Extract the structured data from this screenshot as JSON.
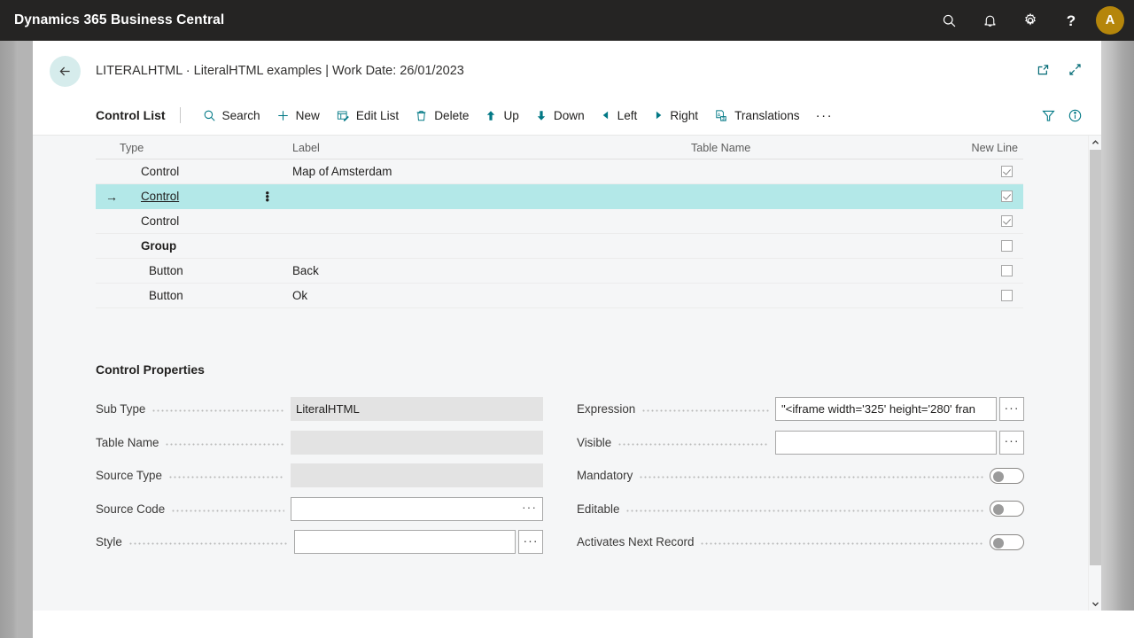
{
  "topbar": {
    "brand": "Dynamics 365 Business Central",
    "icons": {
      "search": "search-icon",
      "notifications": "bell-icon",
      "settings": "gear-icon",
      "help": "?",
      "avatar_initial": "A"
    },
    "colors": {
      "background": "#252423",
      "avatar": "#b5860b"
    }
  },
  "page_header": {
    "back_label": "back-arrow",
    "title": "LITERALHTML · LiteralHTML examples | Work Date: 26/01/2023",
    "icons": [
      "open-in-new-window-icon",
      "collapse-icon"
    ]
  },
  "command_bar": {
    "title": "Control List",
    "buttons": [
      {
        "label": "Search",
        "icon": "search-icon"
      },
      {
        "label": "New",
        "icon": "plus-icon"
      },
      {
        "label": "Edit List",
        "icon": "edit-list-icon"
      },
      {
        "label": "Delete",
        "icon": "trash-icon"
      },
      {
        "label": "Up",
        "icon": "arrow-up-icon"
      },
      {
        "label": "Down",
        "icon": "arrow-down-icon"
      },
      {
        "label": "Left",
        "icon": "triangle-left-icon"
      },
      {
        "label": "Right",
        "icon": "triangle-right-icon"
      },
      {
        "label": "Translations",
        "icon": "translations-icon"
      }
    ],
    "overflow": "···",
    "right_icons": [
      "filter-icon",
      "info-icon"
    ],
    "accent": "#017885"
  },
  "table": {
    "columns": [
      "Type",
      "Label",
      "Table Name",
      "New Line"
    ],
    "rows": [
      {
        "indicator": "",
        "type": "Control",
        "label": "Map of Amsterdam",
        "table_name": "",
        "new_line": true,
        "selected": false,
        "bold": false,
        "indent": false
      },
      {
        "indicator": "→",
        "type": "Control",
        "label": "",
        "table_name": "",
        "new_line": true,
        "selected": true,
        "bold": false,
        "indent": false
      },
      {
        "indicator": "",
        "type": "Control",
        "label": "",
        "table_name": "",
        "new_line": true,
        "selected": false,
        "bold": false,
        "indent": false
      },
      {
        "indicator": "",
        "type": "Group",
        "label": "",
        "table_name": "",
        "new_line": false,
        "selected": false,
        "bold": true,
        "indent": false
      },
      {
        "indicator": "",
        "type": "Button",
        "label": "Back",
        "table_name": "",
        "new_line": false,
        "selected": false,
        "bold": false,
        "indent": true
      },
      {
        "indicator": "",
        "type": "Button",
        "label": "Ok",
        "table_name": "",
        "new_line": false,
        "selected": false,
        "bold": false,
        "indent": true
      }
    ],
    "selected_row_color": "#b3e8e8",
    "row_kebab": "⋮"
  },
  "properties": {
    "title": "Control Properties",
    "left_fields": [
      {
        "label": "Sub Type",
        "value": "LiteralHTML",
        "control": "readonly"
      },
      {
        "label": "Table Name",
        "value": "",
        "control": "readonly"
      },
      {
        "label": "Source Type",
        "value": "",
        "control": "readonly"
      },
      {
        "label": "Source Code",
        "value": "",
        "control": "input-assist-inside"
      },
      {
        "label": "Style",
        "value": "",
        "control": "input-assist-outside"
      }
    ],
    "right_fields": [
      {
        "label": "Expression",
        "value": "\"<iframe width='325' height='280' fran",
        "control": "input-assist-outside"
      },
      {
        "label": "Visible",
        "value": "",
        "control": "input-assist-outside"
      },
      {
        "label": "Mandatory",
        "value": "off",
        "control": "toggle"
      },
      {
        "label": "Editable",
        "value": "off",
        "control": "toggle"
      },
      {
        "label": "Activates Next Record",
        "value": "off",
        "control": "toggle"
      }
    ],
    "assist_glyph": "···"
  },
  "scrollbar": {
    "up": "▲",
    "down": "▼"
  }
}
